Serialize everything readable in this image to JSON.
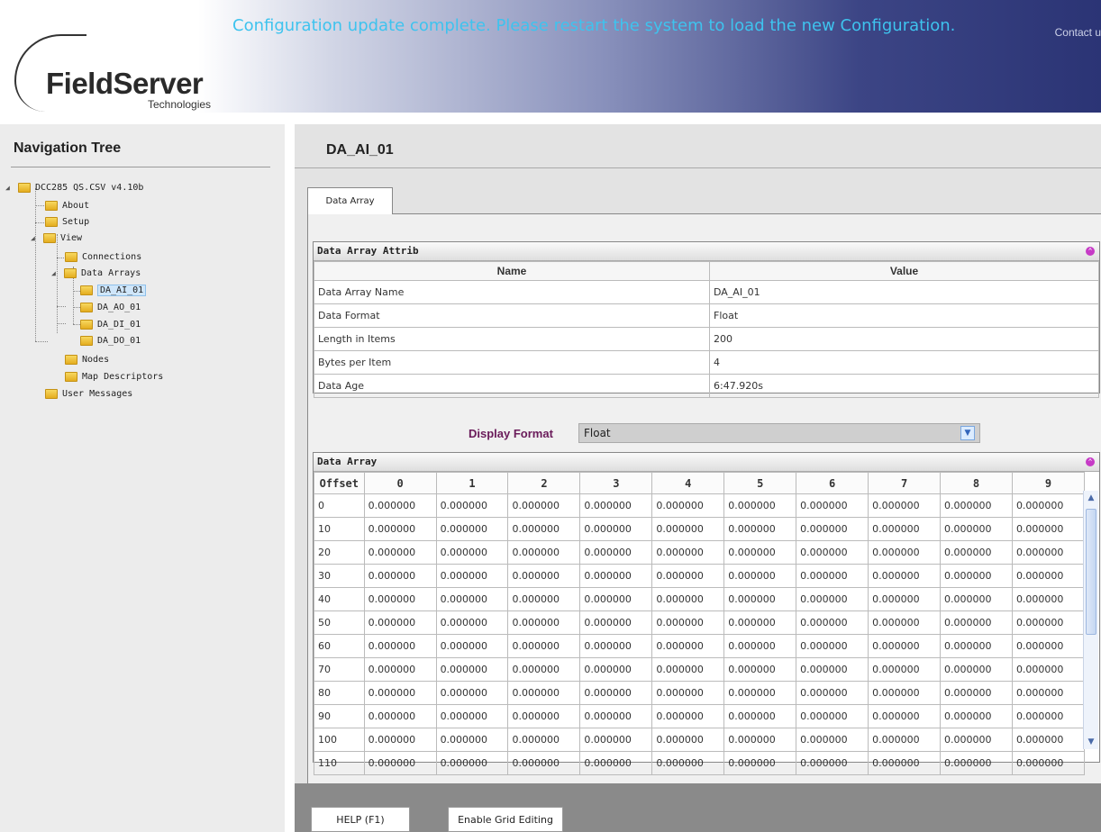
{
  "header": {
    "notice": "Configuration update complete. Please restart the system to load the new Configuration.",
    "contact": "Contact u",
    "logo_name": "FieldServer",
    "logo_sub": "Technologies"
  },
  "nav": {
    "title": "Navigation Tree",
    "items": [
      {
        "label": "DCC285 QS.CSV v4.10b"
      },
      {
        "label": "About"
      },
      {
        "label": "Setup"
      },
      {
        "label": "View"
      },
      {
        "label": "Connections"
      },
      {
        "label": "Data Arrays"
      },
      {
        "label": "DA_AI_01"
      },
      {
        "label": "DA_AO_01"
      },
      {
        "label": "DA_DI_01"
      },
      {
        "label": "DA_DO_01"
      },
      {
        "label": "Nodes"
      },
      {
        "label": "Map Descriptors"
      },
      {
        "label": "User Messages"
      }
    ]
  },
  "main": {
    "title": "DA_AI_01",
    "tab": "Data Array",
    "attrib": {
      "title": "Data Array Attrib",
      "col_name": "Name",
      "col_value": "Value",
      "rows": [
        {
          "name": "Data Array Name",
          "value": "DA_AI_01"
        },
        {
          "name": "Data Format",
          "value": "Float"
        },
        {
          "name": "Length in Items",
          "value": "200"
        },
        {
          "name": "Bytes per Item",
          "value": "4"
        },
        {
          "name": "Data Age",
          "value": "6:47.920s"
        }
      ]
    },
    "display_format": {
      "label": "Display Format",
      "value": "Float"
    },
    "grid": {
      "title": "Data Array",
      "headers": [
        "Offset",
        "0",
        "1",
        "2",
        "3",
        "4",
        "5",
        "6",
        "7",
        "8",
        "9"
      ],
      "rows": [
        {
          "offset": "0",
          "values": [
            "0.000000",
            "0.000000",
            "0.000000",
            "0.000000",
            "0.000000",
            "0.000000",
            "0.000000",
            "0.000000",
            "0.000000",
            "0.000000"
          ]
        },
        {
          "offset": "10",
          "values": [
            "0.000000",
            "0.000000",
            "0.000000",
            "0.000000",
            "0.000000",
            "0.000000",
            "0.000000",
            "0.000000",
            "0.000000",
            "0.000000"
          ]
        },
        {
          "offset": "20",
          "values": [
            "0.000000",
            "0.000000",
            "0.000000",
            "0.000000",
            "0.000000",
            "0.000000",
            "0.000000",
            "0.000000",
            "0.000000",
            "0.000000"
          ]
        },
        {
          "offset": "30",
          "values": [
            "0.000000",
            "0.000000",
            "0.000000",
            "0.000000",
            "0.000000",
            "0.000000",
            "0.000000",
            "0.000000",
            "0.000000",
            "0.000000"
          ]
        },
        {
          "offset": "40",
          "values": [
            "0.000000",
            "0.000000",
            "0.000000",
            "0.000000",
            "0.000000",
            "0.000000",
            "0.000000",
            "0.000000",
            "0.000000",
            "0.000000"
          ]
        },
        {
          "offset": "50",
          "values": [
            "0.000000",
            "0.000000",
            "0.000000",
            "0.000000",
            "0.000000",
            "0.000000",
            "0.000000",
            "0.000000",
            "0.000000",
            "0.000000"
          ]
        },
        {
          "offset": "60",
          "values": [
            "0.000000",
            "0.000000",
            "0.000000",
            "0.000000",
            "0.000000",
            "0.000000",
            "0.000000",
            "0.000000",
            "0.000000",
            "0.000000"
          ]
        },
        {
          "offset": "70",
          "values": [
            "0.000000",
            "0.000000",
            "0.000000",
            "0.000000",
            "0.000000",
            "0.000000",
            "0.000000",
            "0.000000",
            "0.000000",
            "0.000000"
          ]
        },
        {
          "offset": "80",
          "values": [
            "0.000000",
            "0.000000",
            "0.000000",
            "0.000000",
            "0.000000",
            "0.000000",
            "0.000000",
            "0.000000",
            "0.000000",
            "0.000000"
          ]
        },
        {
          "offset": "90",
          "values": [
            "0.000000",
            "0.000000",
            "0.000000",
            "0.000000",
            "0.000000",
            "0.000000",
            "0.000000",
            "0.000000",
            "0.000000",
            "0.000000"
          ]
        },
        {
          "offset": "100",
          "values": [
            "0.000000",
            "0.000000",
            "0.000000",
            "0.000000",
            "0.000000",
            "0.000000",
            "0.000000",
            "0.000000",
            "0.000000",
            "0.000000"
          ]
        },
        {
          "offset": "110",
          "values": [
            "0.000000",
            "0.000000",
            "0.000000",
            "0.000000",
            "0.000000",
            "0.000000",
            "0.000000",
            "0.000000",
            "0.000000",
            "0.000000"
          ]
        }
      ]
    }
  },
  "footer": {
    "help": "HELP (F1)",
    "edit": "Enable Grid Editing"
  }
}
